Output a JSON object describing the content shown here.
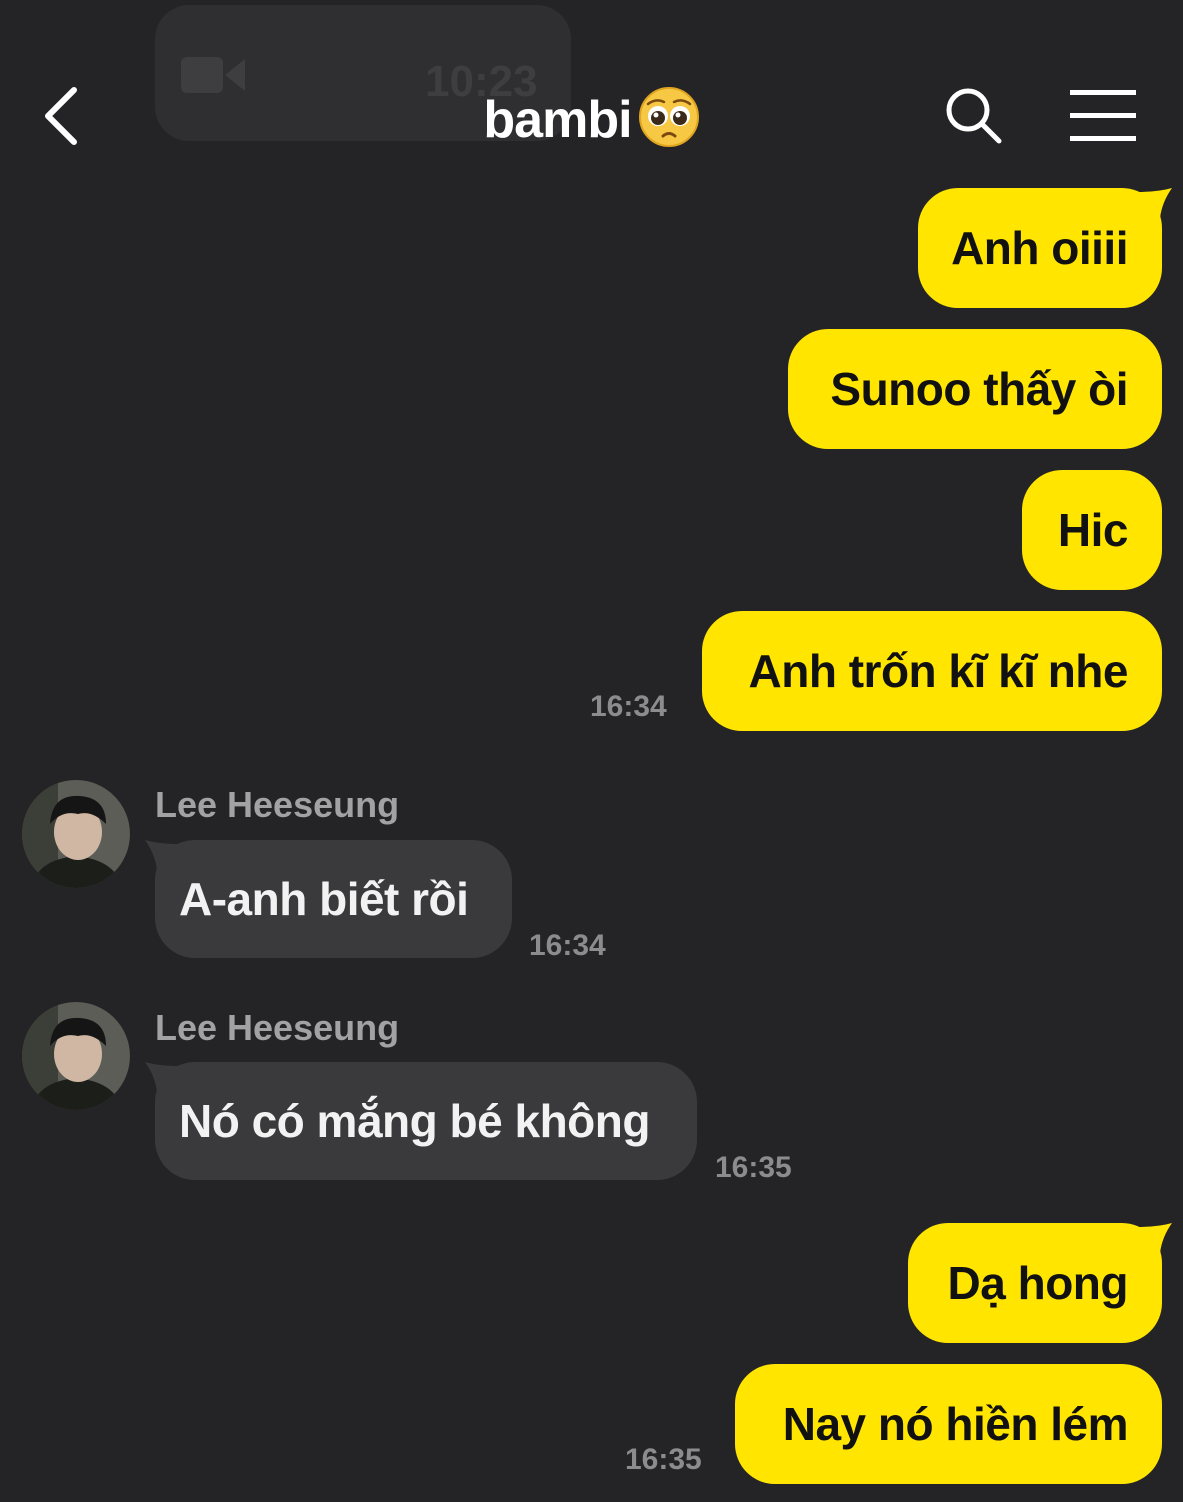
{
  "header": {
    "title": "bambi",
    "title_emoji": "pleading-face-emoji",
    "back_icon": "chevron-left-icon",
    "search_icon": "search-icon",
    "menu_icon": "hamburger-menu-icon"
  },
  "ghost_call": {
    "icon": "video-camera-icon",
    "time": "10:23"
  },
  "messages": [
    {
      "from": "me",
      "text": "Anh oiiii"
    },
    {
      "from": "me",
      "text": "Sunoo thấy òi"
    },
    {
      "from": "me",
      "text": "Hic"
    },
    {
      "from": "me",
      "text": "Anh trốn kĩ kĩ nhe",
      "time": "16:34"
    },
    {
      "from": "them",
      "sender": "Lee Heeseung",
      "text": "A-anh biết rồi",
      "time": "16:34"
    },
    {
      "from": "them",
      "sender": "Lee Heeseung",
      "text": "Nó có mắng bé không",
      "time": "16:35"
    },
    {
      "from": "me",
      "text": "Dạ hong"
    },
    {
      "from": "me",
      "text": "Nay nó hiền lém",
      "time": "16:35"
    }
  ],
  "colors": {
    "background": "#242426",
    "my_bubble": "#ffe500",
    "their_bubble": "#3a3a3c",
    "timestamp": "#8c8c8e"
  }
}
